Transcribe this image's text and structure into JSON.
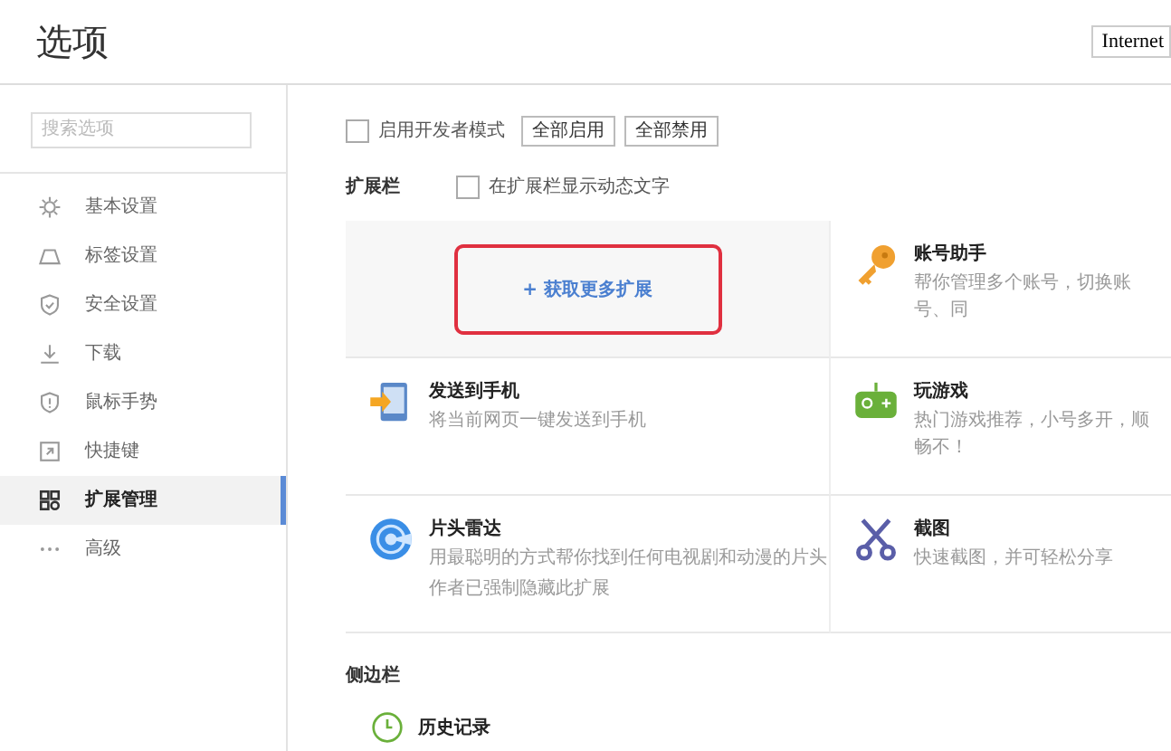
{
  "header": {
    "title": "选项",
    "dropdown": "Internet"
  },
  "sidebar": {
    "search": {
      "placeholder": "搜索选项"
    },
    "items": [
      {
        "label": "基本设置",
        "selected": false
      },
      {
        "label": "标签设置",
        "selected": false
      },
      {
        "label": "安全设置",
        "selected": false
      },
      {
        "label": "下载",
        "selected": false
      },
      {
        "label": "鼠标手势",
        "selected": false
      },
      {
        "label": "快捷键",
        "selected": false
      },
      {
        "label": "扩展管理",
        "selected": true
      },
      {
        "label": "高级",
        "selected": false
      }
    ]
  },
  "toolbar": {
    "dev_mode": {
      "label": "启用开发者模式",
      "checked": false
    },
    "buttons": [
      "全部启用",
      "全部禁用"
    ]
  },
  "extension_bar": {
    "title": "扩展栏",
    "option": {
      "label": "在扩展栏显示动态文字",
      "checked": false
    },
    "get_more": "+ 获取更多扩展",
    "extensions": [
      {
        "name": "账号助手",
        "description": "帮你管理多个账号，切换账号、同"
      },
      {
        "name": "发送到手机",
        "description": "将当前网页一键发送到手机"
      },
      {
        "name": "玩游戏",
        "description": "热门游戏推荐，小号多开，顺畅不！"
      },
      {
        "name": "片头雷达",
        "description": "用最聪明的方式帮你找到任何电视剧和动漫的片头",
        "note": "作者已强制隐藏此扩展"
      },
      {
        "name": "截图",
        "description": "快速截图，并可轻松分享"
      }
    ]
  },
  "sidebar_section": {
    "title": "侧边栏",
    "items": [
      {
        "name": "历史记录"
      }
    ]
  }
}
